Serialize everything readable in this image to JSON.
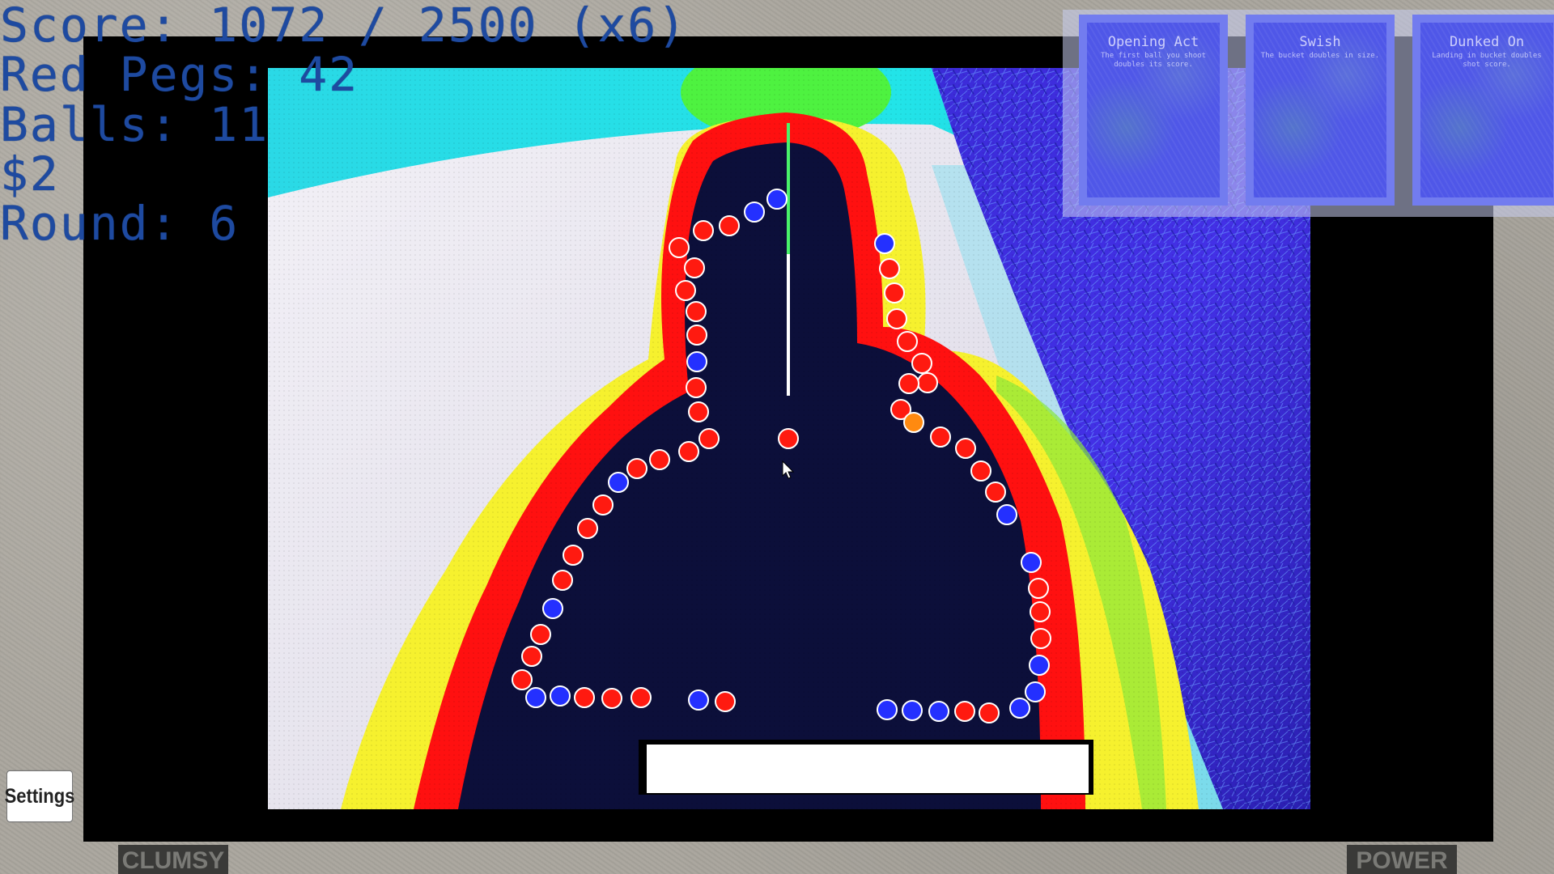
{
  "hud": {
    "score_line": "Score: 1072 / 2500 (x6)",
    "red_pegs_line": "Red Pegs: 42",
    "balls_line": "Balls: 11",
    "money_line": "$2",
    "round_line": "Round: 6"
  },
  "powerups": [
    {
      "title": "Opening Act",
      "description": "The first ball you shoot doubles its score."
    },
    {
      "title": "Swish",
      "description": "The bucket doubles in size."
    },
    {
      "title": "Dunked On",
      "description": "Landing in bucket doubles shot score."
    }
  ],
  "settings_label": "Settings",
  "bottom_tags": {
    "left": "CLUMSY",
    "right": "POWER"
  },
  "colors": {
    "peg_red": "#ff1a10",
    "peg_blue": "#2430ff",
    "peg_orange": "#ff8a10",
    "hud_text": "#1e4aa0",
    "card_blue": "#4f57e8"
  },
  "pegs": {
    "red_count_shown": 42
  }
}
